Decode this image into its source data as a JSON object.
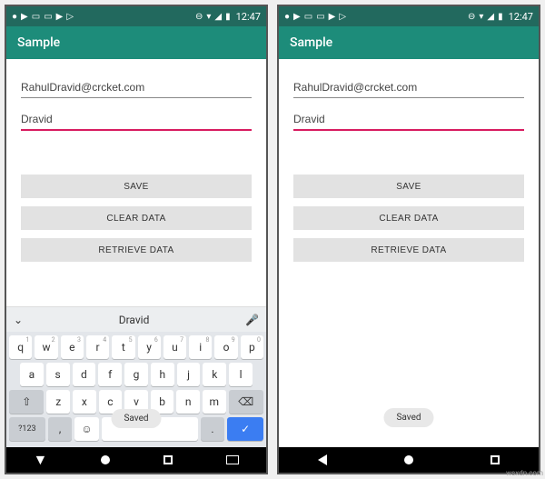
{
  "status": {
    "time": "12:47",
    "icons_left": [
      "●",
      "▶",
      "□",
      "□",
      "▶",
      "▷"
    ],
    "icons_right": [
      "⊖",
      "▾",
      "▲",
      "▮"
    ]
  },
  "app": {
    "title": "Sample"
  },
  "form": {
    "email_value": "RahulDravid@crcket.com",
    "name_value_left": "Dravid",
    "name_value_right": "Dravid"
  },
  "buttons": {
    "save": "SAVE",
    "clear": "CLEAR DATA",
    "retrieve": "RETRIEVE DATA"
  },
  "toast": {
    "message": "Saved"
  },
  "keyboard": {
    "suggestion": "Dravid",
    "row1": [
      "q",
      "w",
      "e",
      "r",
      "t",
      "y",
      "u",
      "i",
      "o",
      "p"
    ],
    "row1_sup": [
      "1",
      "2",
      "3",
      "4",
      "5",
      "6",
      "7",
      "8",
      "9",
      "0"
    ],
    "row2": [
      "a",
      "s",
      "d",
      "f",
      "g",
      "h",
      "j",
      "k",
      "l"
    ],
    "row3_shift": "⇧",
    "row3": [
      "z",
      "x",
      "c",
      "v",
      "b",
      "n",
      "m"
    ],
    "row3_bksp": "⌫",
    "row4_sym": "?123",
    "row4_comma": ",",
    "row4_emoji": "☺",
    "row4_period": ".",
    "row4_enter": "✓"
  },
  "watermark": "wsxdn.com"
}
